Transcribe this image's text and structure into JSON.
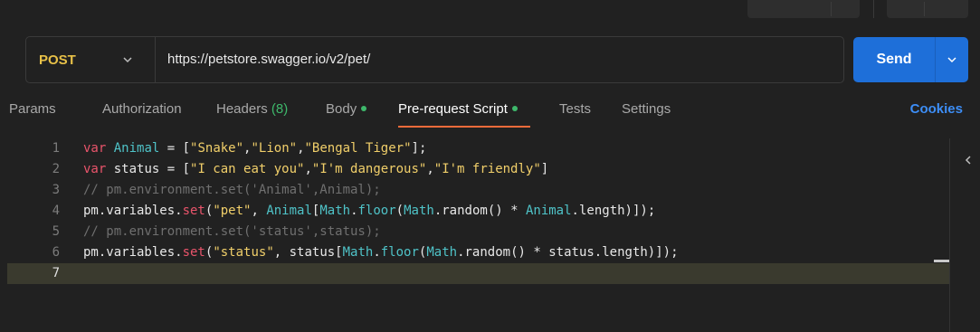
{
  "request": {
    "method": "POST",
    "url": "https://petstore.swagger.io/v2/pet/",
    "send_label": "Send"
  },
  "tabs": [
    {
      "label": "Params"
    },
    {
      "label": "Authorization"
    },
    {
      "label": "Headers",
      "count": "(8)"
    },
    {
      "label": "Body",
      "has_dot": true
    },
    {
      "label": "Pre-request Script",
      "has_dot": true,
      "active": true
    },
    {
      "label": "Tests"
    },
    {
      "label": "Settings"
    }
  ],
  "cookies_label": "Cookies",
  "editor": {
    "current_line": 7,
    "lines": [
      {
        "num": "1",
        "tokens": [
          [
            "kw",
            "var"
          ],
          [
            "id",
            " "
          ],
          [
            "cls",
            "Animal"
          ],
          [
            "id",
            " = ["
          ],
          [
            "str",
            "\"Snake\""
          ],
          [
            "id",
            ","
          ],
          [
            "str",
            "\"Lion\""
          ],
          [
            "id",
            ","
          ],
          [
            "str",
            "\"Bengal Tiger\""
          ],
          [
            "id",
            "];"
          ]
        ]
      },
      {
        "num": "2",
        "tokens": [
          [
            "kw",
            "var"
          ],
          [
            "id",
            " status = ["
          ],
          [
            "str",
            "\"I can eat you\""
          ],
          [
            "id",
            ","
          ],
          [
            "str",
            "\"I'm dangerous\""
          ],
          [
            "id",
            ","
          ],
          [
            "str",
            "\"I'm friendly\""
          ],
          [
            "id",
            "]"
          ]
        ]
      },
      {
        "num": "3",
        "tokens": [
          [
            "cm",
            "// pm.environment.set('Animal',Animal);"
          ]
        ]
      },
      {
        "num": "4",
        "tokens": [
          [
            "id",
            "pm.variables."
          ],
          [
            "kw",
            "set"
          ],
          [
            "id",
            "("
          ],
          [
            "str",
            "\"pet\""
          ],
          [
            "id",
            ", "
          ],
          [
            "cls",
            "Animal"
          ],
          [
            "id",
            "["
          ],
          [
            "cls",
            "Math"
          ],
          [
            "id",
            "."
          ],
          [
            "cls",
            "floor"
          ],
          [
            "id",
            "("
          ],
          [
            "cls",
            "Math"
          ],
          [
            "id",
            ".random() * "
          ],
          [
            "cls",
            "Animal"
          ],
          [
            "id",
            ".length)]);"
          ]
        ]
      },
      {
        "num": "5",
        "tokens": [
          [
            "cm",
            "// pm.environment.set('status',status);"
          ]
        ]
      },
      {
        "num": "6",
        "tokens": [
          [
            "id",
            "pm.variables."
          ],
          [
            "kw",
            "set"
          ],
          [
            "id",
            "("
          ],
          [
            "str",
            "\"status\""
          ],
          [
            "id",
            ", status["
          ],
          [
            "cls",
            "Math"
          ],
          [
            "id",
            "."
          ],
          [
            "cls",
            "floor"
          ],
          [
            "id",
            "("
          ],
          [
            "cls",
            "Math"
          ],
          [
            "id",
            ".random() * status.length)]);"
          ]
        ]
      },
      {
        "num": "7",
        "tokens": []
      }
    ]
  },
  "icons": {
    "method_dropdown": "chevron-down-icon",
    "send_dropdown": "chevron-down-icon",
    "side_panel": "chevron-left-icon"
  }
}
